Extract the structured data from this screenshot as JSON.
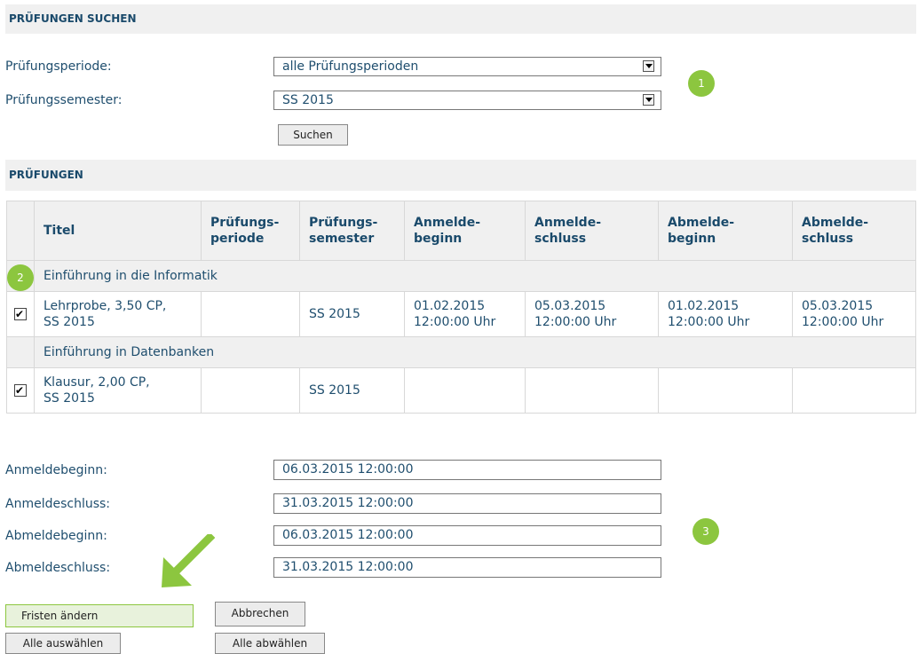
{
  "search": {
    "header": "PRÜFUNGEN SUCHEN",
    "period_label": "Prüfungsperiode:",
    "period_value": "alle Prüfungsperioden",
    "semester_label": "Prüfungssemester:",
    "semester_value": "SS 2015",
    "search_button": "Suchen"
  },
  "exams": {
    "header": "PRÜFUNGEN",
    "columns": {
      "titel": "Titel",
      "periode": [
        "Prüfungs-",
        "periode"
      ],
      "semester": [
        "Prüfungs-",
        "semester"
      ],
      "anmeldebeginn": [
        "Anmelde-",
        "beginn"
      ],
      "anmeldeschluss": [
        "Anmelde-",
        "schluss"
      ],
      "abmeldebeginn": [
        "Abmelde-",
        "beginn"
      ],
      "abmeldeschluss": [
        "Abmelde-",
        "schluss"
      ]
    },
    "groups": [
      {
        "name": "Einführung in die Informatik",
        "rows": [
          {
            "checked": true,
            "title": [
              "Lehrprobe, 3,50 CP,",
              "SS 2015"
            ],
            "period": "",
            "semester": "SS 2015",
            "anmeldebeginn": [
              "01.02.2015",
              "12:00:00 Uhr"
            ],
            "anmeldeschluss": [
              "05.03.2015",
              "12:00:00 Uhr"
            ],
            "abmeldebeginn": [
              "01.02.2015",
              "12:00:00 Uhr"
            ],
            "abmeldeschluss": [
              "05.03.2015",
              "12:00:00 Uhr"
            ]
          }
        ]
      },
      {
        "name": "Einführung in Datenbanken",
        "rows": [
          {
            "checked": true,
            "title": [
              "Klausur, 2,00 CP,",
              "SS 2015"
            ],
            "period": "",
            "semester": "SS 2015",
            "anmeldebeginn": [
              "",
              ""
            ],
            "anmeldeschluss": [
              "",
              ""
            ],
            "abmeldebeginn": [
              "",
              ""
            ],
            "abmeldeschluss": [
              "",
              ""
            ]
          }
        ]
      }
    ]
  },
  "deadlines": {
    "anmeldebeginn_label": "Anmeldebeginn:",
    "anmeldebeginn_value": "06.03.2015 12:00:00",
    "anmeldeschluss_label": "Anmeldeschluss:",
    "anmeldeschluss_value": "31.03.2015 12:00:00",
    "abmeldebeginn_label": "Abmeldebeginn:",
    "abmeldebeginn_value": "06.03.2015 12:00:00",
    "abmeldeschluss_label": "Abmeldeschluss:",
    "abmeldeschluss_value": "31.03.2015 12:00:00"
  },
  "actions": {
    "change": "Fristen ändern",
    "cancel": "Abbrechen",
    "select_all": "Alle auswählen",
    "deselect_all": "Alle abwählen"
  },
  "badges": {
    "b1": "1",
    "b2": "2",
    "b3": "3"
  },
  "colors": {
    "accent": "#8cc63f",
    "text": "#1f4e6e",
    "header_bg": "#f0f0f0"
  },
  "icons": {
    "highlight_arrow": "arrow-down-left-icon",
    "select_arrow": "chevron-down-icon"
  }
}
